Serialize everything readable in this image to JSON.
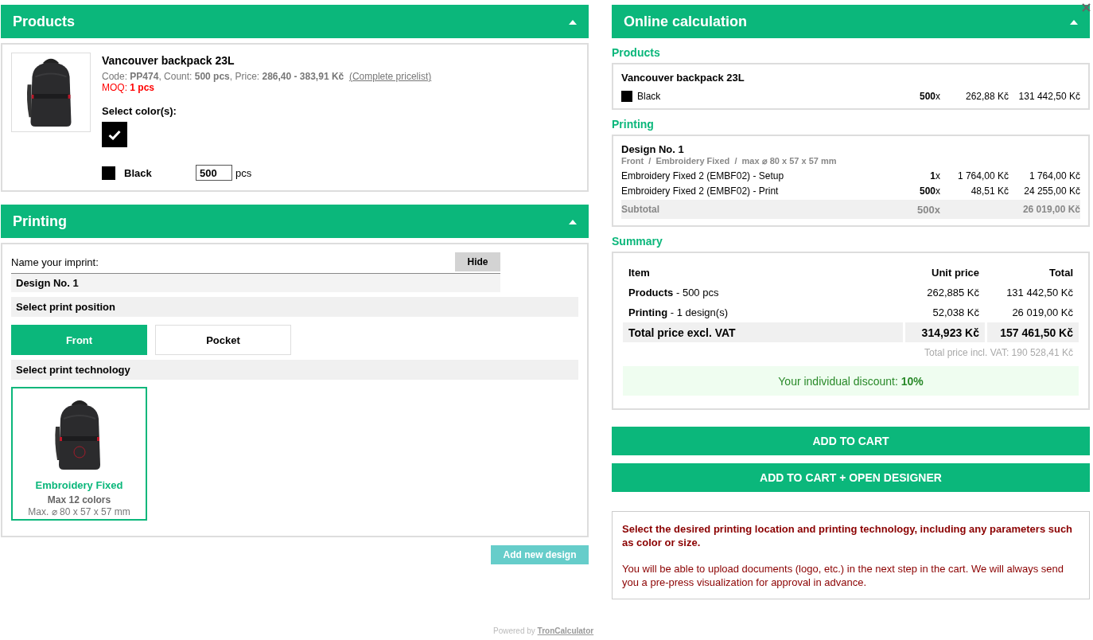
{
  "products_panel": {
    "title": "Products",
    "expanded": true,
    "product": {
      "name": "Vancouver backpack 23L",
      "details": "Code: **PP474**, Count: **500 pcs**, Price: **286,40 - 383,91 Kč**",
      "pricelist_link": "(Complete pricelist)",
      "moq": "MOQ: **1 pcs**",
      "select_label": "Select color(s):",
      "colors": [
        {
          "name": "Black",
          "color": "#000000",
          "selected": true,
          "quantity": "500",
          "unit": "pcs"
        }
      ]
    }
  },
  "printing_panel": {
    "title": "Printing",
    "expanded": true,
    "name_label": "Name your imprint:",
    "hide_button": "Hide",
    "imprint_name": "Design No. 1",
    "position_label": "Select print position",
    "positions": [
      {
        "label": "Front",
        "selected": true
      },
      {
        "label": "Pocket",
        "selected": false
      }
    ],
    "technology_label": "Select print technology",
    "technologies": [
      {
        "name": "Embroidery Fixed",
        "colors": "Max 12 colors",
        "size": "Max. ⌀ 80 x 57 x 57 mm",
        "selected": true
      }
    ],
    "add_button": "Add new design"
  },
  "footer": {
    "prefix": "Powered by",
    "link": "TronCalculator"
  },
  "calculation": {
    "title": "Online calculation",
    "expanded": true,
    "products_label": "Products",
    "product": {
      "name": "Vancouver backpack 23L",
      "rows": [
        {
          "color": "#000000",
          "name": "Black",
          "qty": "**500**x",
          "unit_price": "262,88 Kč",
          "total": "131 442,50 Kč"
        }
      ]
    },
    "printing_label": "Printing",
    "design": {
      "name": "Design No. 1",
      "path": "Front  /  Embroidery Fixed  /  max ⌀ 80 x 57 x 57 mm",
      "lines": [
        {
          "name": "Embroidery Fixed 2 (EMBF02) - Setup",
          "qty": "**1**x",
          "unit_price": "1 764,00 Kč",
          "total": "1 764,00 Kč"
        },
        {
          "name": "Embroidery Fixed 2 (EMBF02) - Print",
          "qty": "**500**x",
          "unit_price": "48,51 Kč",
          "total": "24 255,00 Kč"
        }
      ],
      "subtotal": {
        "label": "Subtotal",
        "qty": "500x",
        "total": "26 019,00 Kč"
      }
    },
    "summary_label": "Summary",
    "summary": {
      "columns": [
        "Item",
        "Unit price",
        "Total"
      ],
      "rows": [
        {
          "item": "**Products** - 500 pcs",
          "unit_price": "262,885 Kč",
          "total": "131 442,50 Kč"
        },
        {
          "item": "**Printing** - 1 design(s)",
          "unit_price": "52,038 Kč",
          "total": "26 019,00 Kč"
        }
      ],
      "total": {
        "label": "Total price excl. VAT",
        "unit_price": "314,923 Kč",
        "total": "157 461,50 Kč"
      },
      "vat": "Total price incl. VAT: 190 528,41 Kč",
      "discount": "Your individual discount: **10%**"
    },
    "buttons": [
      "ADD TO CART",
      "ADD TO CART + OPEN DESIGNER"
    ],
    "note": {
      "heading": "Select the desired printing location and printing technology, including any parameters such as color or size.",
      "text": "You will be able to upload documents (logo, etc.) in the next step in the cart. We will always send you a pre-press visualization for approval in advance."
    }
  }
}
